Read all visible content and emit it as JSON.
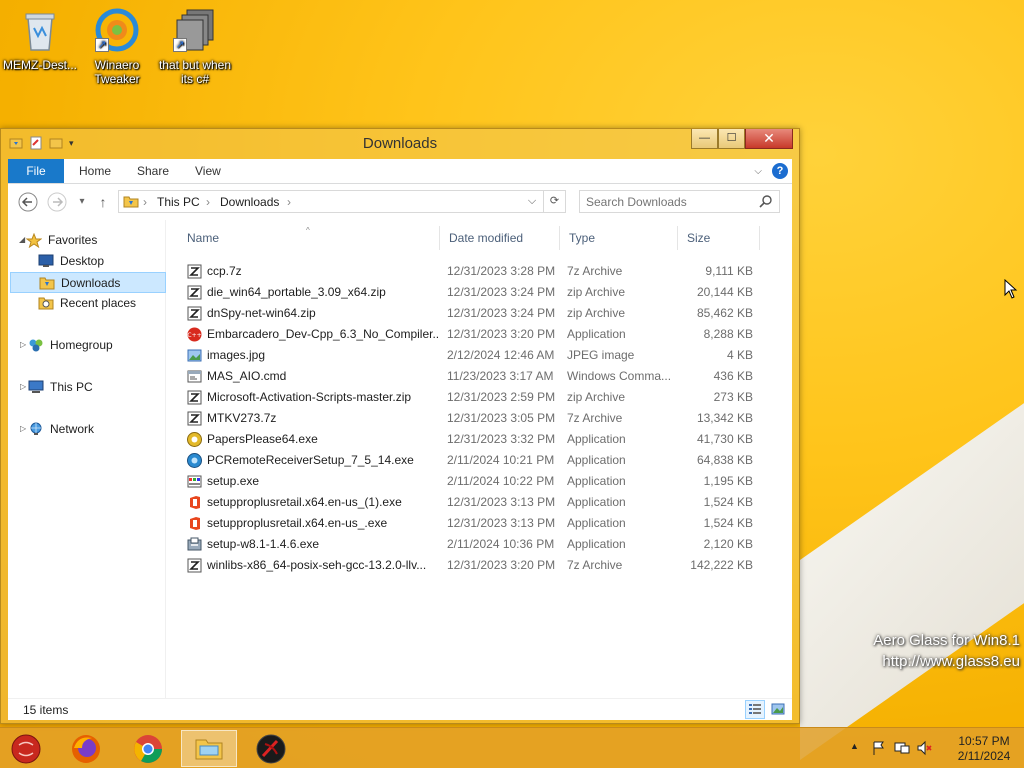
{
  "desktop": {
    "icons": [
      {
        "label_line1": "MEMZ-Dest...",
        "label_line2": ""
      },
      {
        "label_line1": "Winaero",
        "label_line2": "Tweaker"
      },
      {
        "label_line1": "that but when",
        "label_line2": "its c#"
      }
    ],
    "watermark": {
      "line1": "Aero Glass for Win8.1",
      "line2": "http://www.glass8.eu"
    }
  },
  "window": {
    "title": "Downloads",
    "buttons": {
      "minimize": "—",
      "maximize": "☐",
      "close": "✕"
    }
  },
  "ribbon": {
    "tabs": [
      "File",
      "Home",
      "Share",
      "View"
    ],
    "expand_icon": "chevron-down-icon",
    "help": "?"
  },
  "navigation": {
    "back": "←",
    "forward": "→",
    "recent": "▾",
    "up": "↑",
    "address": {
      "segments": [
        "This PC",
        "Downloads"
      ],
      "separator": "›"
    },
    "refresh": "⟳",
    "search": {
      "placeholder": "Search Downloads"
    }
  },
  "navpane": {
    "favorites": {
      "label": "Favorites",
      "items": [
        "Desktop",
        "Downloads",
        "Recent places"
      ],
      "selected": "Downloads"
    },
    "roots": [
      "Homegroup",
      "This PC",
      "Network"
    ]
  },
  "columns": {
    "name": "Name",
    "date": "Date modified",
    "type": "Type",
    "size": "Size"
  },
  "files": [
    {
      "name": "ccp.7z",
      "date": "12/31/2023 3:28 PM",
      "type": "7z Archive",
      "size": "9,111 KB",
      "icon": "archive-icon"
    },
    {
      "name": "die_win64_portable_3.09_x64.zip",
      "date": "12/31/2023 3:24 PM",
      "type": "zip Archive",
      "size": "20,144 KB",
      "icon": "archive-icon"
    },
    {
      "name": "dnSpy-net-win64.zip",
      "date": "12/31/2023 3:24 PM",
      "type": "zip Archive",
      "size": "85,462 KB",
      "icon": "archive-icon"
    },
    {
      "name": "Embarcadero_Dev-Cpp_6.3_No_Compiler...",
      "date": "12/31/2023 3:20 PM",
      "type": "Application",
      "size": "8,288 KB",
      "icon": "devcpp-icon"
    },
    {
      "name": "images.jpg",
      "date": "2/12/2024 12:46 AM",
      "type": "JPEG image",
      "size": "4 KB",
      "icon": "image-icon"
    },
    {
      "name": "MAS_AIO.cmd",
      "date": "11/23/2023 3:17 AM",
      "type": "Windows Comma...",
      "size": "436 KB",
      "icon": "cmd-icon"
    },
    {
      "name": "Microsoft-Activation-Scripts-master.zip",
      "date": "12/31/2023 2:59 PM",
      "type": "zip Archive",
      "size": "273 KB",
      "icon": "archive-icon"
    },
    {
      "name": "MTKV273.7z",
      "date": "12/31/2023 3:05 PM",
      "type": "7z Archive",
      "size": "13,342 KB",
      "icon": "archive-icon"
    },
    {
      "name": "PapersPlease64.exe",
      "date": "12/31/2023 3:32 PM",
      "type": "Application",
      "size": "41,730 KB",
      "icon": "papers-please-icon"
    },
    {
      "name": "PCRemoteReceiverSetup_7_5_14.exe",
      "date": "2/11/2024 10:21 PM",
      "type": "Application",
      "size": "64,838 KB",
      "icon": "remote-icon"
    },
    {
      "name": "setup.exe",
      "date": "2/11/2024 10:22 PM",
      "type": "Application",
      "size": "1,195 KB",
      "icon": "setup-icon"
    },
    {
      "name": "setupproplusretail.x64.en-us_(1).exe",
      "date": "12/31/2023 3:13 PM",
      "type": "Application",
      "size": "1,524 KB",
      "icon": "office-icon"
    },
    {
      "name": "setupproplusretail.x64.en-us_.exe",
      "date": "12/31/2023 3:13 PM",
      "type": "Application",
      "size": "1,524 KB",
      "icon": "office-icon"
    },
    {
      "name": "setup-w8.1-1.4.6.exe",
      "date": "2/11/2024 10:36 PM",
      "type": "Application",
      "size": "2,120 KB",
      "icon": "installer-icon"
    },
    {
      "name": "winlibs-x86_64-posix-seh-gcc-13.2.0-llv...",
      "date": "12/31/2023 3:20 PM",
      "type": "7z Archive",
      "size": "142,222 KB",
      "icon": "archive-icon"
    }
  ],
  "status": {
    "count": "15 items"
  },
  "taskbar": {
    "apps": [
      "start-orb-icon",
      "firefox-icon",
      "chrome-icon",
      "file-explorer-icon",
      "app-icon"
    ],
    "clock": {
      "time": "10:57 PM",
      "date": "2/11/2024"
    }
  },
  "colors": {
    "accent": "#1979ca",
    "selection": "#cce8ff",
    "desktop": "#ffc41a"
  }
}
